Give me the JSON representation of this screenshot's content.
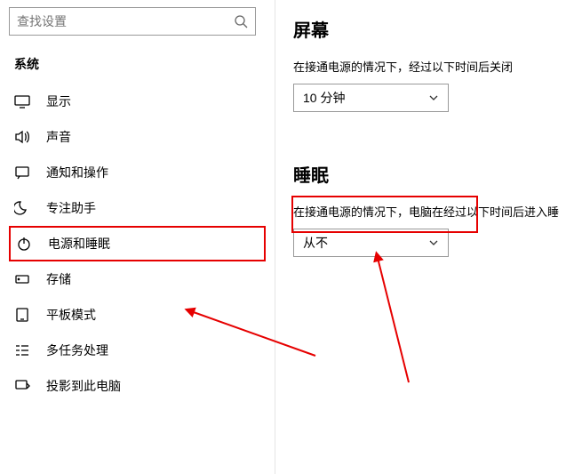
{
  "search": {
    "placeholder": "查找设置"
  },
  "sidebar": {
    "section_label": "系统",
    "items": [
      {
        "label": "显示"
      },
      {
        "label": "声音"
      },
      {
        "label": "通知和操作"
      },
      {
        "label": "专注助手"
      },
      {
        "label": "电源和睡眠"
      },
      {
        "label": "存储"
      },
      {
        "label": "平板模式"
      },
      {
        "label": "多任务处理"
      },
      {
        "label": "投影到此电脑"
      }
    ]
  },
  "content": {
    "screen": {
      "heading": "屏幕",
      "desc": "在接通电源的情况下，经过以下时间后关闭",
      "value": "10 分钟"
    },
    "sleep": {
      "heading": "睡眠",
      "desc": "在接通电源的情况下，电脑在经过以下时间后进入睡",
      "value": "从不"
    }
  },
  "colors": {
    "highlight": "#e60000"
  }
}
